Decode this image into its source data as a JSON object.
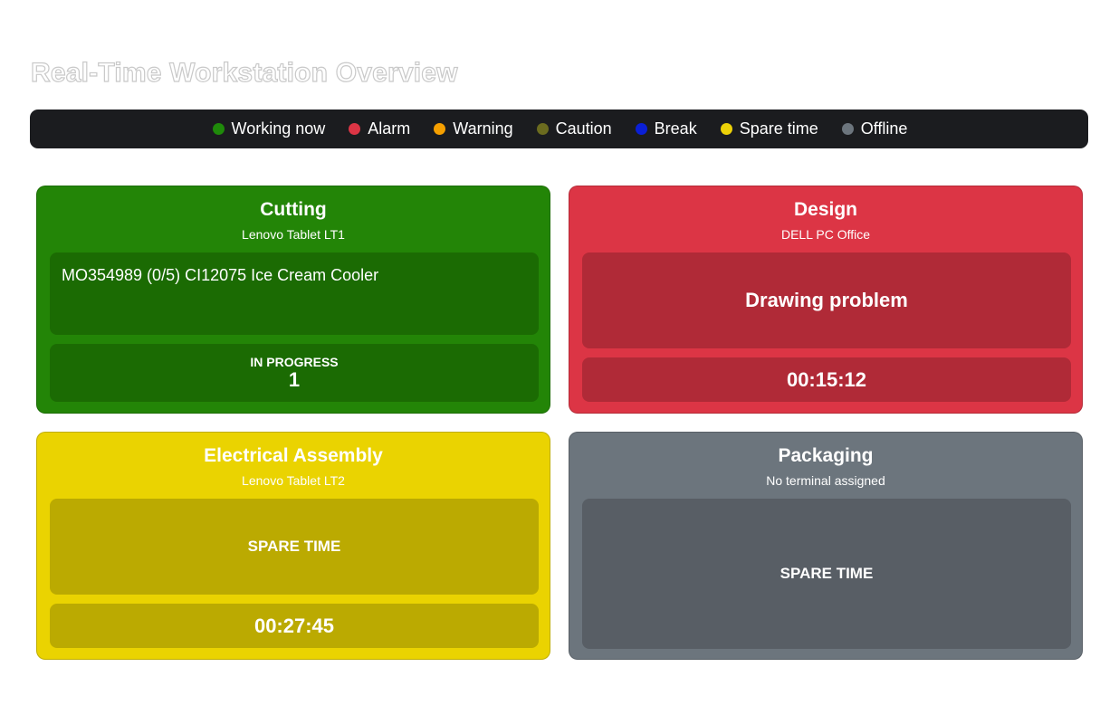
{
  "page": {
    "title": "Real-Time Workstation Overview"
  },
  "legend": [
    {
      "label": "Working now",
      "color": "#1f8a0a"
    },
    {
      "label": "Alarm",
      "color": "#dc3545"
    },
    {
      "label": "Warning",
      "color": "#f59f00"
    },
    {
      "label": "Caution",
      "color": "#6b6b1f"
    },
    {
      "label": "Break",
      "color": "#0a1fd6"
    },
    {
      "label": "Spare time",
      "color": "#ecd108"
    },
    {
      "label": "Offline",
      "color": "#6c757d"
    }
  ],
  "workstations": {
    "cutting": {
      "name": "Cutting",
      "terminal": "Lenovo Tablet LT1",
      "order": "MO354989 (0/5) CI12075 Ice Cream Cooler",
      "status_label": "IN PROGRESS",
      "count": "1",
      "color": "#238507"
    },
    "design": {
      "name": "Design",
      "terminal": "DELL PC Office",
      "message": "Drawing problem",
      "timer": "00:15:12",
      "color": "#dc3545"
    },
    "electrical": {
      "name": "Electrical Assembly",
      "terminal": "Lenovo Tablet LT2",
      "message": "SPARE TIME",
      "timer": "00:27:45",
      "color": "#ead301"
    },
    "packaging": {
      "name": "Packaging",
      "terminal": "No terminal assigned",
      "message": "SPARE TIME",
      "color": "#6c757d"
    }
  }
}
